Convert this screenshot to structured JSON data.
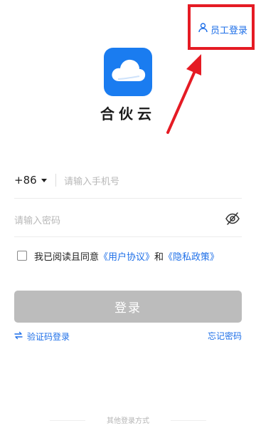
{
  "header": {
    "staff_login_label": "员工登录",
    "staff_icon": "person-icon"
  },
  "app": {
    "name": "合伙云",
    "logo_icon": "cloud-icon"
  },
  "phone": {
    "country_code": "+86",
    "placeholder": "请输入手机号",
    "value": ""
  },
  "password": {
    "placeholder": "请输入密码",
    "value": "",
    "toggle_icon": "eye-off-icon"
  },
  "agreement": {
    "text": "我已阅读且同意",
    "user_agreement": "《用户协议》",
    "and": "和",
    "privacy_policy": "《隐私政策》",
    "checked": false
  },
  "login_button": {
    "label": "登录"
  },
  "sms_login": {
    "label": "验证码登录",
    "icon": "switch-arrows-icon"
  },
  "forgot_password": {
    "label": "忘记密码"
  },
  "other_login": {
    "label": "其他登录方式"
  },
  "colors": {
    "accent": "#1e6fe8",
    "logo_bg": "#1a7cf0",
    "button_disabled": "#bcbcbc",
    "annotation": "#e51b24"
  }
}
